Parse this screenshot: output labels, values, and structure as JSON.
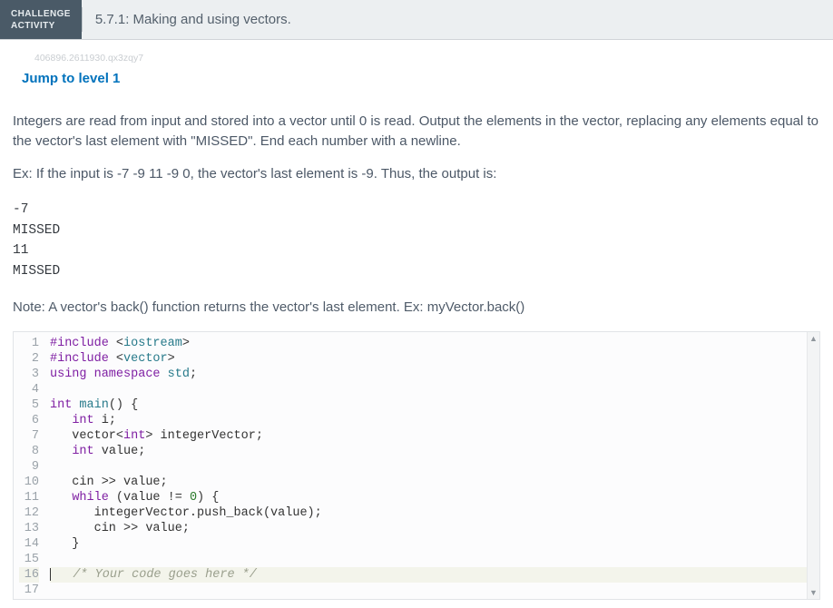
{
  "header": {
    "challenge_label_line1": "CHALLENGE",
    "challenge_label_line2": "ACTIVITY",
    "title": "5.7.1: Making and using vectors."
  },
  "watermark": "406896.2611930.qx3zqy7",
  "jump_link": "Jump to level 1",
  "prompt_p1": "Integers are read from input and stored into a vector until 0 is read. Output the elements in the vector, replacing any elements equal to the vector's last element with \"MISSED\". End each number with a newline.",
  "prompt_p2": "Ex: If the input is -7 -9 11 -9 0, the vector's last element is -9. Thus, the output is:",
  "example_output": "-7\nMISSED\n11\nMISSED",
  "note": "Note: A vector's back() function returns the vector's last element. Ex: myVector.back()",
  "code": {
    "lines": [
      {
        "n": 1,
        "tokens": [
          [
            "kw",
            "#include "
          ],
          [
            "op",
            "<"
          ],
          [
            "type",
            "iostream"
          ],
          [
            "op",
            ">"
          ]
        ]
      },
      {
        "n": 2,
        "tokens": [
          [
            "kw",
            "#include "
          ],
          [
            "op",
            "<"
          ],
          [
            "type",
            "vector"
          ],
          [
            "op",
            ">"
          ]
        ]
      },
      {
        "n": 3,
        "tokens": [
          [
            "kw",
            "using "
          ],
          [
            "kw",
            "namespace "
          ],
          [
            "type",
            "std"
          ],
          [
            "op",
            ";"
          ]
        ]
      },
      {
        "n": 4,
        "tokens": []
      },
      {
        "n": 5,
        "tokens": [
          [
            "kw",
            "int "
          ],
          [
            "type",
            "main"
          ],
          [
            "op",
            "() {"
          ]
        ]
      },
      {
        "n": 6,
        "tokens": [
          [
            "",
            "   "
          ],
          [
            "kw",
            "int "
          ],
          [
            "",
            "i;"
          ]
        ]
      },
      {
        "n": 7,
        "tokens": [
          [
            "",
            "   vector<"
          ],
          [
            "kw",
            "int"
          ],
          [
            "",
            "> integerVector;"
          ]
        ]
      },
      {
        "n": 8,
        "tokens": [
          [
            "",
            "   "
          ],
          [
            "kw",
            "int "
          ],
          [
            "",
            "value;"
          ]
        ]
      },
      {
        "n": 9,
        "tokens": []
      },
      {
        "n": 10,
        "tokens": [
          [
            "",
            "   cin >> value;"
          ]
        ]
      },
      {
        "n": 11,
        "tokens": [
          [
            "",
            "   "
          ],
          [
            "kw",
            "while "
          ],
          [
            "",
            "(value != "
          ],
          [
            "num",
            "0"
          ],
          [
            "",
            ") {"
          ]
        ]
      },
      {
        "n": 12,
        "tokens": [
          [
            "",
            "      integerVector.push_back(value);"
          ]
        ]
      },
      {
        "n": 13,
        "tokens": [
          [
            "",
            "      cin >> value;"
          ]
        ]
      },
      {
        "n": 14,
        "tokens": [
          [
            "",
            "   }"
          ]
        ]
      },
      {
        "n": 15,
        "tokens": []
      },
      {
        "n": 16,
        "tokens": [
          [
            "",
            "   "
          ],
          [
            "cmt",
            "/* Your code goes here */"
          ]
        ],
        "highlight": true,
        "cursor": true
      },
      {
        "n": 17,
        "tokens": []
      }
    ]
  },
  "scrollbar": {
    "up_glyph": "▲",
    "down_glyph": "▼"
  }
}
